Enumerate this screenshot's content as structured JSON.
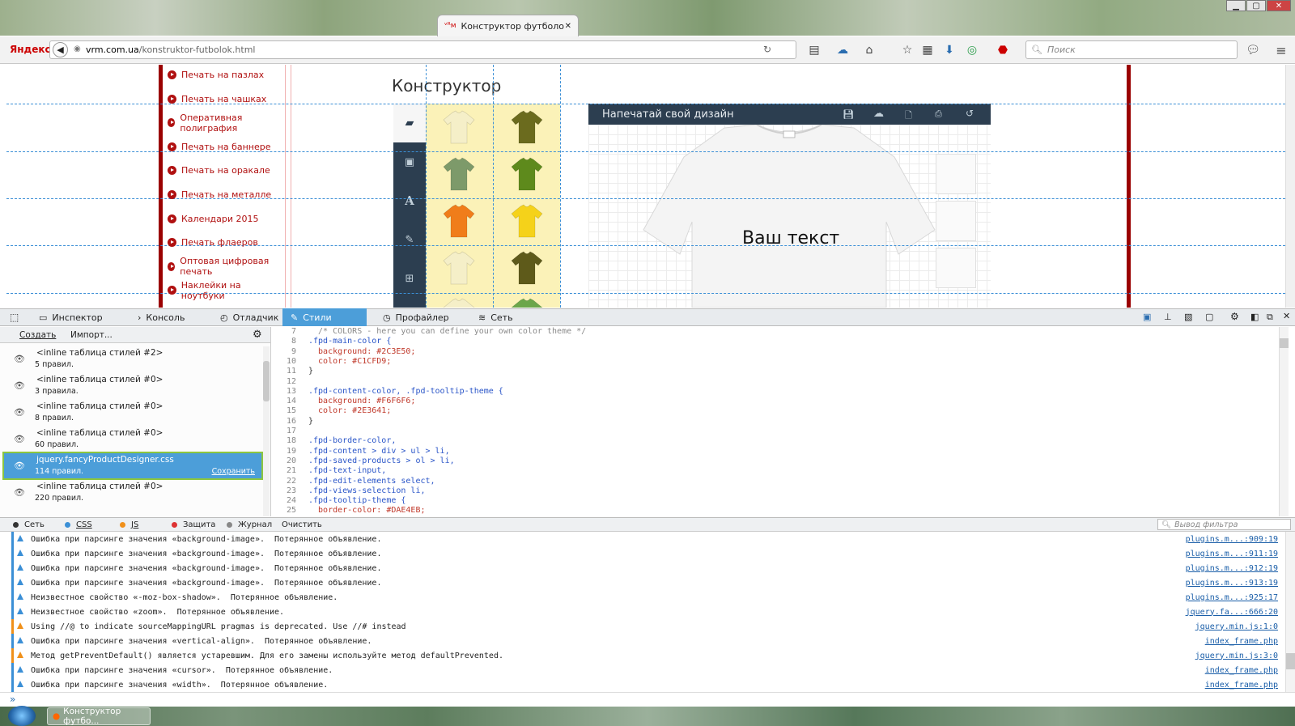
{
  "browser": {
    "tab_title": "Конструктор футболок о...",
    "tab_close": "✕",
    "yandex_label": "Яндекс",
    "url_domain": "vrm.com.ua",
    "url_path": "/konstruktor-futbolok.html",
    "search_placeholder": "Поиск"
  },
  "page": {
    "menu": [
      "Печать на пазлах",
      "Печать на чашках",
      "Оперативная полиграфия",
      "Печать на баннере",
      "Печать на оракале",
      "Печать на металле",
      "Календари 2015",
      "Печать флаеров",
      "Оптовая цифровая печать",
      "Наклейки на ноутбуки"
    ],
    "constructor_title": "Конструктор",
    "designer_title": "Напечатай свой дизайн",
    "shirt_text": "Ваш текст",
    "shirt_colors": [
      "#f5efc8",
      "#6b6b1e",
      "#7d9a6a",
      "#5e8a1c",
      "#f07d1a",
      "#f5d21a",
      "#f5efc8",
      "#5e5a1a",
      "#f5efc8",
      "#6ba64a"
    ],
    "colors": {
      "designer_bar": "#2C3E50",
      "accent_red": "#9a0000",
      "swatch_bg": "#fbf2b8",
      "tool_bar": "#2c3e50"
    }
  },
  "devtools": {
    "tabs": [
      "Инспектор",
      "Консоль",
      "Отладчик",
      "Стили",
      "Профайлер",
      "Сеть"
    ],
    "active_tab": "Стили",
    "create_label": "Создать",
    "import_label": "Импорт...",
    "sheets": [
      {
        "name": "<inline таблица стилей #2>",
        "rules": "5 правил."
      },
      {
        "name": "<inline таблица стилей #0>",
        "rules": "3 правила."
      },
      {
        "name": "<inline таблица стилей #0>",
        "rules": "8 правил."
      },
      {
        "name": "<inline таблица стилей #0>",
        "rules": "60 правил."
      },
      {
        "name": "jquery.fancyProductDesigner.css",
        "rules": "114 правил.",
        "save": "Сохранить"
      },
      {
        "name": "<inline таблица стилей #0>",
        "rules": "220 правил."
      }
    ],
    "code_lines": [
      {
        "n": "7",
        "t": "  /* COLORS - here you can define your own color theme */"
      },
      {
        "n": "8",
        "t": ".fpd-main-color {"
      },
      {
        "n": "9",
        "t": "  background: #2C3E50;"
      },
      {
        "n": "10",
        "t": "  color: #C1CFD9;"
      },
      {
        "n": "11",
        "t": "}"
      },
      {
        "n": "12",
        "t": ""
      },
      {
        "n": "13",
        "t": ".fpd-content-color, .fpd-tooltip-theme {"
      },
      {
        "n": "14",
        "t": "  background: #F6F6F6;"
      },
      {
        "n": "15",
        "t": "  color: #2E3641;"
      },
      {
        "n": "16",
        "t": "}"
      },
      {
        "n": "17",
        "t": ""
      },
      {
        "n": "18",
        "t": ".fpd-border-color,"
      },
      {
        "n": "19",
        "t": ".fpd-content > div > ul > li,"
      },
      {
        "n": "20",
        "t": ".fpd-saved-products > ol > li,"
      },
      {
        "n": "21",
        "t": ".fpd-text-input,"
      },
      {
        "n": "22",
        "t": ".fpd-edit-elements select,"
      },
      {
        "n": "23",
        "t": ".fpd-views-selection li,"
      },
      {
        "n": "24",
        "t": ".fpd-tooltip-theme {"
      },
      {
        "n": "25",
        "t": "  border-color: #DAE4EB;"
      }
    ],
    "filters": [
      "Сеть",
      "CSS",
      "JS",
      "Защита",
      "Журнал",
      "Очистить"
    ],
    "filter_placeholder": "Вывод фильтра",
    "console": [
      {
        "msg": "Ошибка при парсинге значения «background-image».  Потерянное объявление.",
        "src": "plugins.m...:909:19",
        "level": "css"
      },
      {
        "msg": "Ошибка при парсинге значения «background-image».  Потерянное объявление.",
        "src": "plugins.m...:911:19",
        "level": "css"
      },
      {
        "msg": "Ошибка при парсинге значения «background-image».  Потерянное объявление.",
        "src": "plugins.m...:912:19",
        "level": "css"
      },
      {
        "msg": "Ошибка при парсинге значения «background-image».  Потерянное объявление.",
        "src": "plugins.m...:913:19",
        "level": "css"
      },
      {
        "msg": "Неизвестное свойство «-moz-box-shadow».  Потерянное объявление.",
        "src": "plugins.m...:925:17",
        "level": "css"
      },
      {
        "msg": "Неизвестное свойство «zoom».  Потерянное объявление.",
        "src": "jquery.fa...:666:20",
        "level": "css"
      },
      {
        "msg": "Using //@ to indicate sourceMappingURL pragmas is deprecated. Use //# instead",
        "src": "jquery.min.js:1:0",
        "level": "js"
      },
      {
        "msg": "Ошибка при парсинге значения «vertical-align».  Потерянное объявление.",
        "src": "index_frame.php",
        "level": "css"
      },
      {
        "msg": "Метод getPreventDefault() является устаревшим. Для его замены используйте метод defaultPrevented.",
        "src": "jquery.min.js:3:0",
        "level": "js"
      },
      {
        "msg": "Ошибка при парсинге значения «cursor».  Потерянное объявление.",
        "src": "index_frame.php",
        "level": "css"
      },
      {
        "msg": "Ошибка при парсинге значения «width».  Потерянное объявление.",
        "src": "index_frame.php",
        "level": "css"
      }
    ]
  },
  "taskbar": {
    "item": "Конструктор футбо..."
  }
}
